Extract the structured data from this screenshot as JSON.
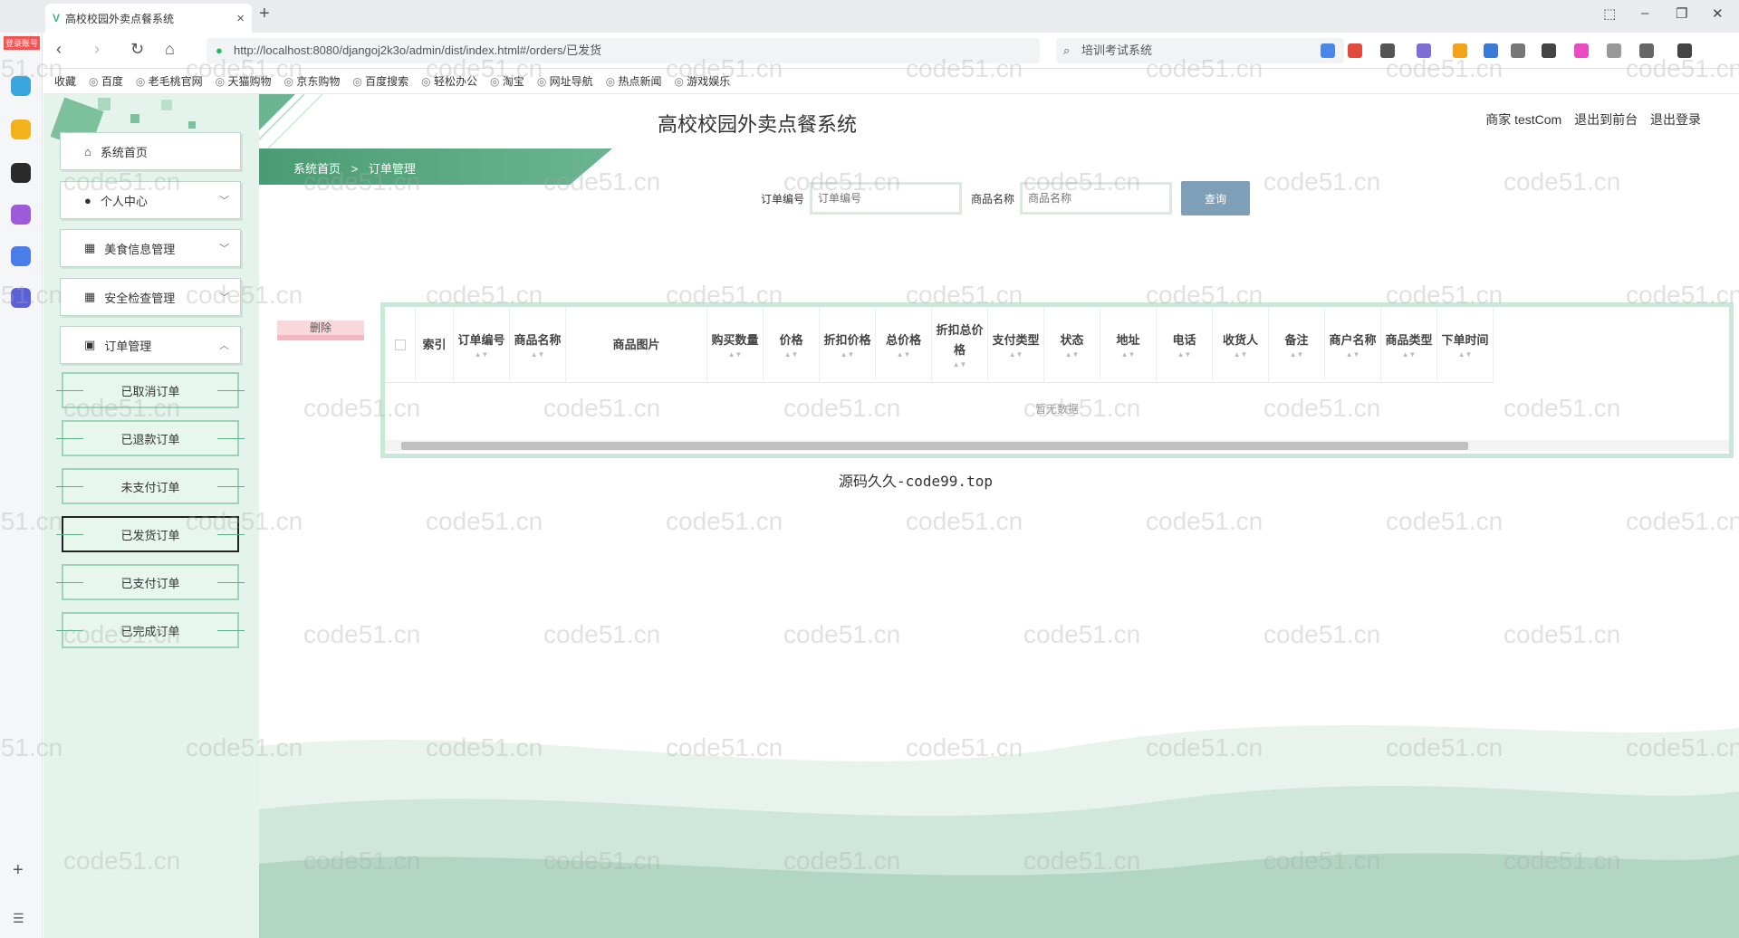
{
  "browser": {
    "tab_title": "高校校园外卖点餐系统",
    "url": "http://localhost:8080/djangoj2k3o/admin/dist/index.html#/orders/已发货",
    "search_text": "培训考试系统",
    "left_badge": "登录账号",
    "bookmarks": [
      "收藏",
      "百度",
      "老毛桃官网",
      "天猫购物",
      "京东购物",
      "百度搜索",
      "轻松办公",
      "淘宝",
      "网址导航",
      "热点新闻",
      "游戏娱乐"
    ]
  },
  "app": {
    "title": "高校校园外卖点餐系统",
    "user_label": "商家 testCom",
    "back_front": "退出到前台",
    "logout": "退出登录"
  },
  "sidebar": {
    "menus": [
      {
        "label": "系统首页",
        "icon": "home-icon"
      },
      {
        "label": "个人中心",
        "icon": "user-icon"
      },
      {
        "label": "美食信息管理",
        "icon": "grid-icon"
      },
      {
        "label": "安全检查管理",
        "icon": "grid-icon"
      },
      {
        "label": "订单管理",
        "icon": "clipboard-icon"
      }
    ],
    "submenu": [
      "已取消订单",
      "已退款订单",
      "未支付订单",
      "已发货订单",
      "已支付订单",
      "已完成订单"
    ],
    "active_submenu": "已发货订单"
  },
  "breadcrumb": {
    "home": "系统首页",
    "sep": ">",
    "current": "订单管理"
  },
  "search": {
    "order_no_label": "订单编号",
    "order_no_placeholder": "订单编号",
    "product_label": "商品名称",
    "product_placeholder": "商品名称",
    "query_button": "查询"
  },
  "delete_button": "删除",
  "table": {
    "columns": [
      "索引",
      "订单编号",
      "商品名称",
      "商品图片",
      "购买数量",
      "价格",
      "折扣价格",
      "总价格",
      "折扣总价格",
      "支付类型",
      "状态",
      "地址",
      "电话",
      "收货人",
      "备注",
      "商户名称",
      "商品类型",
      "下单时间"
    ],
    "empty_text": "暂无数据"
  },
  "footer_text": "源码久久-code99.top",
  "watermark": "code51.cn",
  "colors": {
    "sidebar_bg": "#e4f4ec",
    "accent_green": "#4a9c74",
    "query_btn": "#7f9fb8",
    "delete_btn": "#f9d8dc"
  }
}
